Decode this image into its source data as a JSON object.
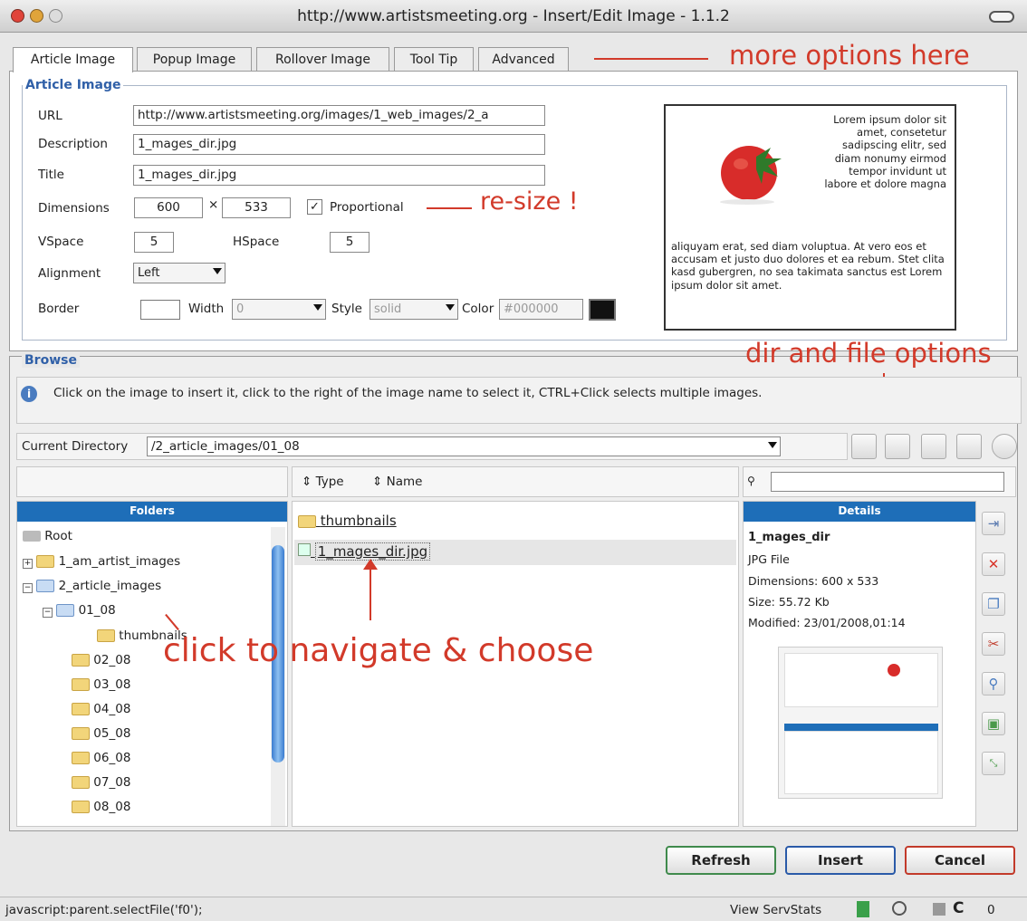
{
  "window": {
    "title": "http://www.artistsmeeting.org - Insert/Edit Image - 1.1.2"
  },
  "tabs": [
    "Article Image",
    "Popup Image",
    "Rollover Image",
    "Tool Tip",
    "Advanced"
  ],
  "annotations": {
    "more_options": "more options here",
    "resize": "re-size !",
    "dir_file": "dir and file options",
    "navigate": "click to navigate & choose"
  },
  "article": {
    "legend": "Article Image",
    "url_label": "URL",
    "url_value": "http://www.artistsmeeting.org/images/1_web_images/2_a",
    "desc_label": "Description",
    "desc_value": "1_mages_dir.jpg",
    "title_label": "Title",
    "title_value": "1_mages_dir.jpg",
    "dim_label": "Dimensions",
    "width": "600",
    "times": "×",
    "height": "533",
    "proportional": "Proportional",
    "check": "✓",
    "vspace_label": "VSpace",
    "vspace": "5",
    "hspace_label": "HSpace",
    "hspace": "5",
    "align_label": "Alignment",
    "align": "Left",
    "border_label": "Border",
    "width_label": "Width",
    "width_val": "0",
    "style_label": "Style",
    "style_val": "solid",
    "color_label": "Color",
    "color_val": "#000000"
  },
  "preview": {
    "text_side": "Lorem ipsum dolor sit amet, consetetur sadipscing elitr, sed diam nonumy eirmod tempor invidunt ut labore et dolore magna",
    "text_below": "aliquyam erat, sed diam voluptua. At vero eos et accusam et justo duo dolores et ea rebum. Stet clita kasd gubergren, no sea takimata sanctus est Lorem ipsum dolor sit amet."
  },
  "browse": {
    "legend": "Browse",
    "info": "Click on the image to insert it, click to the right of the image name to select it, CTRL+Click selects multiple images.",
    "dir_label": "Current Directory",
    "dir_value": "/2_article_images/01_08",
    "sort_type": "Type",
    "sort_name": "Name",
    "folders_head": "Folders",
    "details_head": "Details",
    "tree": {
      "root": "Root",
      "n1": "1_am_artist_images",
      "n2": "2_article_images",
      "n3": "01_08",
      "n4": "thumbnails",
      "months": [
        "02_08",
        "03_08",
        "04_08",
        "05_08",
        "06_08",
        "07_08",
        "08_08"
      ]
    },
    "files": [
      "thumbnails",
      "1_mages_dir.jpg"
    ],
    "details": {
      "name": "1_mages_dir",
      "type": "JPG File",
      "dims": "Dimensions: 600 x 533",
      "size": "Size: 55.72 Kb",
      "modified": "Modified: 23/01/2008,01:14"
    }
  },
  "buttons": {
    "refresh": "Refresh",
    "insert": "Insert",
    "cancel": "Cancel"
  },
  "status": {
    "left": "javascript:parent.selectFile('f0');",
    "servstats": "View ServStats",
    "count": "0"
  },
  "colors": {
    "accent_red": "#d23a2a",
    "header_blue": "#1e6eb8",
    "refresh_border": "#3f8a4c",
    "insert_border": "#2a5aa8",
    "cancel_border": "#c23a2a"
  }
}
